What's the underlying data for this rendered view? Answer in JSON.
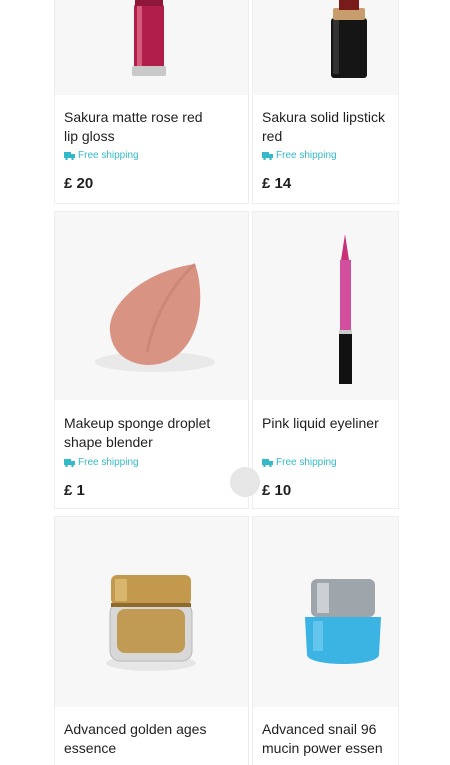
{
  "colors": {
    "shipping": "#33b9c8",
    "text": "#1f1f1f",
    "card_border": "#eeeeee"
  },
  "products": [
    {
      "title": "Sakura matte rose red\nlip gloss",
      "shipping": "Free shipping",
      "price": "£ 20",
      "image": "lip-gloss-tube"
    },
    {
      "title": "Sakura solid lipstick\nred",
      "shipping": "Free shipping",
      "price": "£ 14",
      "image": "black-lipstick"
    },
    {
      "title": "Makeup sponge droplet\nshape blender",
      "shipping": "Free shipping",
      "price": "£ 1",
      "image": "makeup-sponge"
    },
    {
      "title": "Pink liquid eyeliner",
      "shipping": "Free shipping",
      "price": "£ 10",
      "image": "pink-eyeliner"
    },
    {
      "title": "Advanced golden ages\nessence",
      "image": "gold-cream-jar"
    },
    {
      "title": "Advanced snail 96\nmucin power essen",
      "image": "blue-cream-jar"
    }
  ]
}
